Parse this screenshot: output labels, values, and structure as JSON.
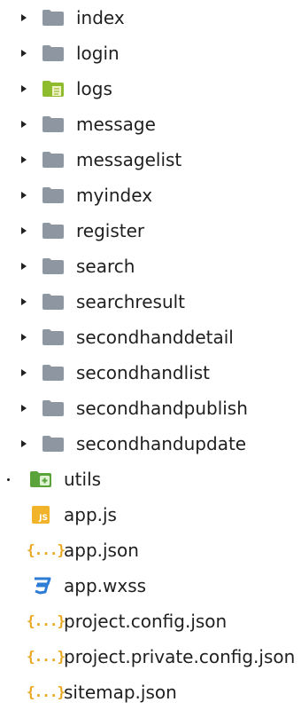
{
  "explorer": {
    "folders": [
      {
        "label": "index",
        "icon": "folder-icon"
      },
      {
        "label": "login",
        "icon": "folder-icon"
      },
      {
        "label": "logs",
        "icon": "logs-folder-icon"
      },
      {
        "label": "message",
        "icon": "folder-icon"
      },
      {
        "label": "messagelist",
        "icon": "folder-icon"
      },
      {
        "label": "myindex",
        "icon": "folder-icon"
      },
      {
        "label": "register",
        "icon": "folder-icon"
      },
      {
        "label": "search",
        "icon": "folder-icon"
      },
      {
        "label": "searchresult",
        "icon": "folder-icon"
      },
      {
        "label": "secondhanddetail",
        "icon": "folder-icon"
      },
      {
        "label": "secondhandlist",
        "icon": "folder-icon"
      },
      {
        "label": "secondhandpublish",
        "icon": "folder-icon"
      },
      {
        "label": "secondhandupdate",
        "icon": "folder-icon"
      }
    ],
    "utils": {
      "label": "utils",
      "icon": "utils-folder-icon"
    },
    "files": [
      {
        "label": "app.js",
        "icon": "js-file-icon"
      },
      {
        "label": "app.json",
        "icon": "json-file-icon"
      },
      {
        "label": "app.wxss",
        "icon": "css-file-icon"
      },
      {
        "label": "project.config.json",
        "icon": "json-file-icon"
      },
      {
        "label": "project.private.config.json",
        "icon": "json-file-icon"
      },
      {
        "label": "sitemap.json",
        "icon": "json-file-icon"
      }
    ],
    "js_badge_text": "JS",
    "json_badge_text": "{...}",
    "colors": {
      "folder": "#8d96a1",
      "logs_folder": "#8fbc2e",
      "utils_folder": "#5aa33a",
      "json": "#e9a820",
      "js": "#f0b32a",
      "css": "#2d7cd6"
    }
  }
}
